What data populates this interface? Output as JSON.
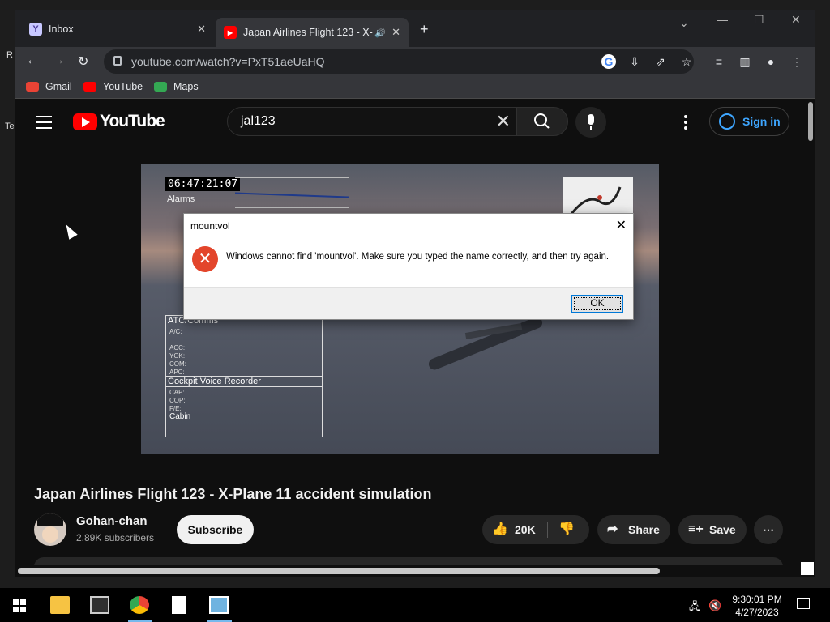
{
  "desktop": {
    "left_text_1": "R",
    "left_text_2": "Te"
  },
  "browser": {
    "tabs": [
      {
        "label": "Inbox",
        "favicon": "Y"
      },
      {
        "label": "Japan Airlines Flight 123 - X-"
      }
    ],
    "new_tab": "+",
    "address": "youtube.com/watch?v=PxT51aeUaHQ",
    "bookmarks": [
      {
        "label": "Gmail",
        "color": "#ea4335"
      },
      {
        "label": "YouTube",
        "color": "#ff0000"
      },
      {
        "label": "Maps",
        "color": "#34a853"
      }
    ]
  },
  "youtube": {
    "logo": "YouTube",
    "search_query": "jal123",
    "sign_in": "Sign in",
    "video": {
      "clock": "06:47:21:07",
      "alarms_label": "Alarms",
      "atc_title": "ATC/Comms",
      "atc_rows": [
        "A/C:",
        "ACC:",
        "YOK:",
        "COM:",
        "APC:"
      ],
      "cvr_title": "Cockpit Voice Recorder",
      "cvr_rows": [
        "CAP:",
        "COP:",
        "F/E:"
      ],
      "cabin": "Cabin"
    },
    "title": "Japan Airlines Flight 123 - X-Plane 11 accident simulation",
    "channel": "Gohan-chan",
    "subscribers": "2.89K subscribers",
    "subscribe": "Subscribe",
    "likes": "20K",
    "share": "Share",
    "save": "Save"
  },
  "dialog": {
    "title": "mountvol",
    "message": "Windows cannot find 'mountvol'. Make sure you typed the name correctly, and then try again.",
    "ok": "OK"
  },
  "taskbar": {
    "time": "9:30:01 PM",
    "date": "4/27/2023"
  },
  "colors": {
    "accent": "#3ea6ff",
    "youtube_red": "#ff0000",
    "error": "#e3452b"
  }
}
